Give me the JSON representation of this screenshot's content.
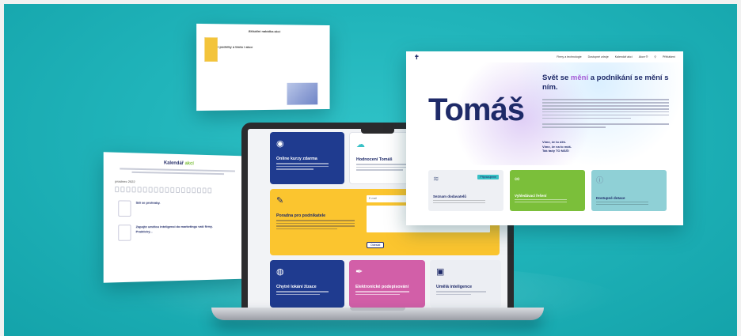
{
  "colors": {
    "background": "#20b4ba",
    "navy": "#1e2a68",
    "brand_teal": "#38c1c6",
    "brand_green": "#7bbf3a",
    "brand_purple": "#a45ad6",
    "tile_yellow": "#fbc52f",
    "tile_pink": "#d25fa8",
    "tile_blue": "#1f3b8f"
  },
  "gallery": {
    "title": "Aktuální nabídka akcí",
    "subtitle": "Kulturní podniky a tímto i akce",
    "tiles": [
      "#1fa7a6",
      "#6cbd45",
      "#101c3c",
      "#6a3fa6",
      "#f3c43b"
    ]
  },
  "calendar": {
    "title_prefix": "Kalendář",
    "title_highlight": " akcí",
    "month": "prosinec 2022",
    "events": [
      "Sdí se prohraby.",
      "Zapojte umělou inteligenci do marketingu vaší firmy. Praktický..."
    ]
  },
  "tomas": {
    "nav": [
      "Firmy a technologie",
      "Dostupné zdroje",
      "Kalendář akcí",
      "Akce ®",
      "Přihlášení"
    ],
    "logo_text": "Tomáš",
    "headline_pre": "Svět se ",
    "headline_highlight": "mění",
    "headline_post": " a podnikání se mění s ním.",
    "motto": "Víme, že to děš.\nVíme, že na to máš.\nTak tady TO MÁŠ!",
    "cards": [
      {
        "title": "Seznam dodavatelů",
        "icon": "layers-icon",
        "color": "#eef0f4",
        "tag": "Připravujeme"
      },
      {
        "title": "Vyhledávací řešení",
        "icon": "link-icon",
        "color": "#7bbf3a"
      },
      {
        "title": "Dostupné dotace",
        "icon": "info-icon",
        "color": "#8fd0d6"
      }
    ]
  },
  "laptop": {
    "tiles": [
      {
        "title": "Online kurzy zdarma",
        "icon": "eye-icon"
      },
      {
        "title": "Hodnocení Tomáš",
        "icon": "cloud-icon"
      },
      {
        "title": "Poradna pro podnikatele",
        "icon": "chat-icon",
        "form_label": "E-mail",
        "button": "Odeslat"
      },
      {
        "title": "Chytré lokání žizace",
        "icon": "globe-icon"
      },
      {
        "title": "Elektronické podepisování",
        "icon": "pen-icon"
      },
      {
        "title": "Umělá inteligence",
        "icon": "chip-icon"
      }
    ]
  }
}
